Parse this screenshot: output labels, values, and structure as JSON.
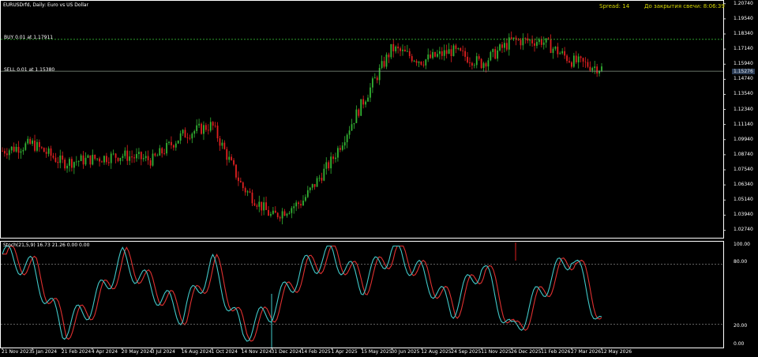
{
  "header": {
    "symbol_title": "EURUSDrfd, Daily:  Euro vs US Dollar",
    "spread_text": "Spread: 14",
    "countdown_text": "До закрытия свечи: 8:06:39"
  },
  "orders": {
    "buy_label": "BUY 0.01 at 1.17911",
    "sell_label": "SELL 0.01 at 1.15380"
  },
  "current_price": "1.15276",
  "price_axis": {
    "ticks": [
      "1.20740",
      "1.19540",
      "1.18340",
      "1.17140",
      "1.15940",
      "1.14740",
      "1.13540",
      "1.12340",
      "1.11140",
      "1.09940",
      "1.08740",
      "1.07540",
      "1.06340",
      "1.05140",
      "1.03940",
      "1.02740"
    ]
  },
  "indicator": {
    "title": "Stoch(21,5,9) 16.73 21.26 0.00 0.00",
    "levels": [
      "100.00",
      "80.00",
      "20.00",
      "0.00"
    ]
  },
  "time_axis": {
    "ticks": [
      "21 Nov 2023",
      "5 Jan 2024",
      "21 Feb 2024",
      "4 Apr 2024",
      "20 May 2024",
      "3 Jul 2024",
      "16 Aug 2024",
      "1 Oct 2024",
      "14 Nov 2024",
      "31 Dec 2024",
      "14 Feb 2025",
      "1 Apr 2025",
      "15 May 2025",
      "30 Jun 2025",
      "12 Aug 2025",
      "24 Sep 2025",
      "11 Nov 2025",
      "26 Dec 2025",
      "11 Feb 2026",
      "27 Mar 2026",
      "12 May 2026"
    ]
  },
  "colors": {
    "background": "#000000",
    "bull_candle": "#33b233",
    "bear_candle": "#e02020",
    "stoch_main": "#40c8c8",
    "stoch_signal": "#e03030",
    "grid_dotted": "#808080",
    "order_line": "#8a9a8a"
  },
  "chart_data": {
    "type": "line",
    "series": [
      {
        "name": "EURUSDrfd",
        "x": [
          "21 Nov 2023",
          "5 Jan 2024",
          "21 Feb 2024",
          "4 Apr 2024",
          "20 May 2024",
          "3 Jul 2024",
          "16 Aug 2024",
          "1 Oct 2024",
          "14 Nov 2024",
          "31 Dec 2024",
          "14 Feb 2025",
          "1 Apr 2025",
          "15 May 2025",
          "30 Jun 2025",
          "12 Aug 2025",
          "24 Sep 2025",
          "11 Nov 2025",
          "26 Dec 2025",
          "11 Feb 2026",
          "27 Mar 2026",
          "12 May 2026"
        ],
        "values": [
          1.0905,
          1.096,
          1.081,
          1.084,
          1.087,
          1.083,
          1.103,
          1.111,
          1.062,
          1.038,
          1.05,
          1.083,
          1.128,
          1.172,
          1.162,
          1.17,
          1.16,
          1.178,
          1.178,
          1.162,
          1.156
        ]
      },
      {
        "name": "Stoch(21,5,9)",
        "x": [
          "21 Nov 2023",
          "5 Jan 2024",
          "21 Feb 2024",
          "4 Apr 2024",
          "20 May 2024",
          "3 Jul 2024",
          "16 Aug 2024",
          "1 Oct 2024",
          "14 Nov 2024",
          "31 Dec 2024",
          "14 Feb 2025",
          "1 Apr 2025",
          "15 May 2025",
          "30 Jun 2025",
          "12 Aug 2025",
          "24 Sep 2025",
          "11 Nov 2025",
          "26 Dec 2025",
          "11 Feb 2026",
          "27 Mar 2026",
          "12 May 2026"
        ],
        "values": [
          90,
          75,
          15,
          40,
          85,
          55,
          30,
          80,
          10,
          35,
          75,
          90,
          60,
          95,
          70,
          35,
          80,
          10,
          55,
          90,
          17
        ]
      }
    ],
    "ylim": [
      1.0214,
      1.2104
    ],
    "grid": false
  }
}
